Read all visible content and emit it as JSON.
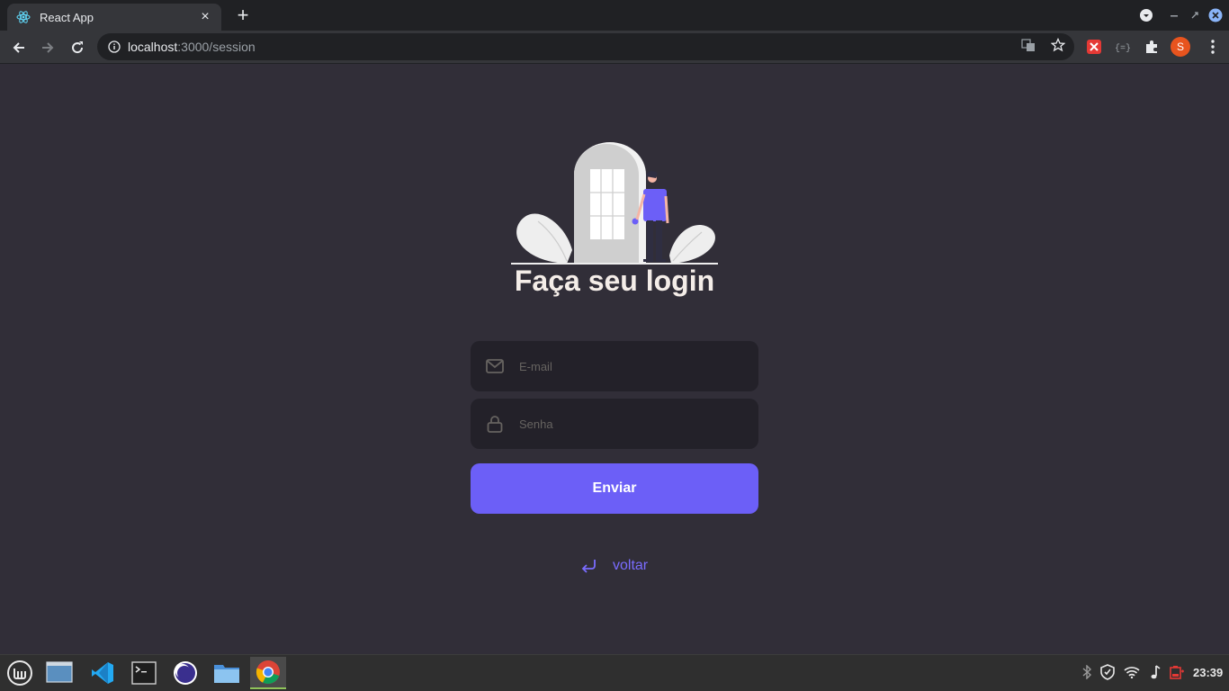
{
  "browser": {
    "tab_title": "React App",
    "tab_close": "×",
    "new_tab": "+",
    "url_host": "localhost",
    "url_path": ":3000/session",
    "profile_initial": "S"
  },
  "login": {
    "heading": "Faça seu login",
    "email_placeholder": "E-mail",
    "password_placeholder": "Senha",
    "submit_label": "Enviar",
    "back_label": "voltar"
  },
  "taskbar": {
    "clock": "23:39"
  },
  "colors": {
    "background": "#312e38",
    "input_background": "#232129",
    "accent": "#6c5ff7",
    "text": "#f4ede8",
    "placeholder": "#666360"
  },
  "icons": {
    "email": "mail-icon",
    "password": "lock-icon",
    "back": "corner-down-left-icon"
  }
}
